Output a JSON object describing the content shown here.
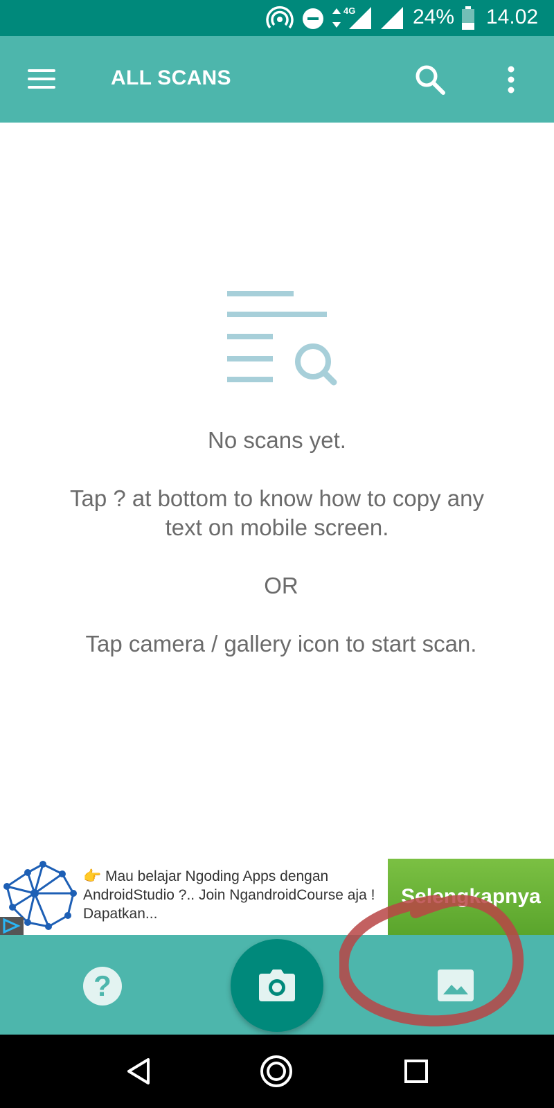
{
  "status_bar": {
    "network": "4G",
    "battery": "24%",
    "time": "14.02"
  },
  "app_bar": {
    "title": "ALL SCANS",
    "icons": [
      "menu-icon",
      "search-icon",
      "more-vert-icon"
    ]
  },
  "empty_state": {
    "icon": "document-search-icon",
    "line1": "No scans yet.",
    "line2": "Tap ? at bottom to know how to copy any text on mobile screen.",
    "or": "OR",
    "line3": "Tap camera / gallery icon to start scan."
  },
  "ad": {
    "text": "👉 Mau belajar Ngoding Apps dengan AndroidStudio ?.. Join NgandroidCourse aja ! Dapatkan...",
    "cta": "Selengkapnya"
  },
  "bottom_bar": {
    "help_label": "?",
    "icons": [
      "help-icon",
      "camera-icon",
      "gallery-icon"
    ]
  },
  "colors": {
    "status_bar": "#00897b",
    "app_bar": "#4db6ac",
    "fab": "#00897b",
    "illustration": "#a7cfd9",
    "annotation": "#b84545"
  }
}
